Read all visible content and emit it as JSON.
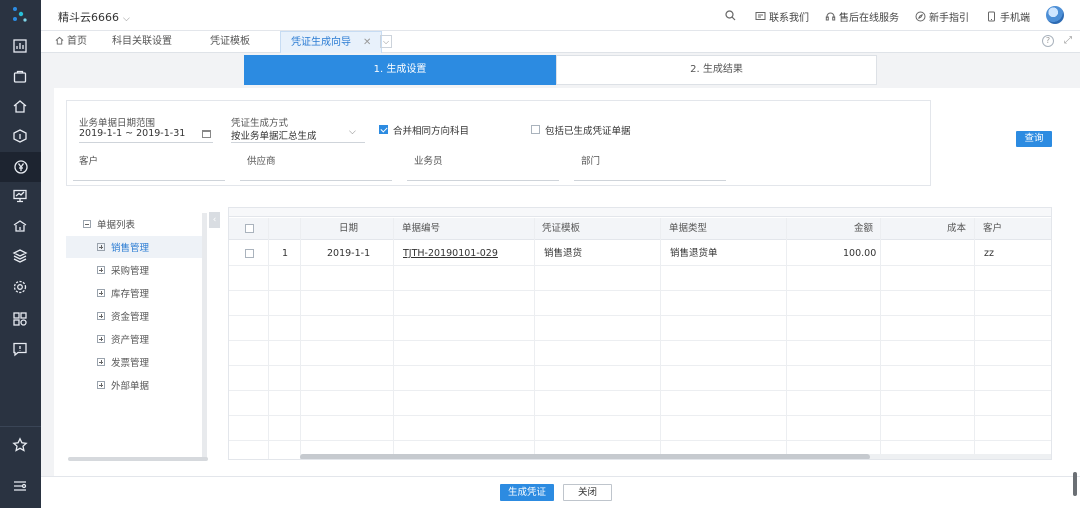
{
  "app": {
    "company_name": "精斗云6666",
    "header_links": [
      {
        "label": "联系我们",
        "icon": "message-icon"
      },
      {
        "label": "售后在线服务",
        "icon": "headset-icon"
      },
      {
        "label": "新手指引",
        "icon": "compass-icon"
      },
      {
        "label": "手机端",
        "icon": "phone-icon"
      }
    ]
  },
  "sidebar": {
    "icons": [
      "chart-icon",
      "bag-icon",
      "home-icon",
      "inventory-icon",
      "yen-icon",
      "report-icon",
      "asset-icon",
      "layers-icon",
      "gear-icon",
      "apps-icon",
      "feedback-icon",
      "star-icon",
      "settings-list-icon"
    ],
    "active": "yen-icon"
  },
  "tabs": [
    {
      "label": "首页",
      "icon": "home-icon"
    },
    {
      "label": "科目关联设置"
    },
    {
      "label": "凭证模板"
    },
    {
      "label": "凭证生成向导",
      "active": true
    }
  ],
  "wizard": {
    "step1": "1. 生成设置",
    "step2": "2. 生成结果"
  },
  "filters": {
    "date_range_label": "业务单据日期范围",
    "date_range_value": "2019-1-1 ~ 2019-1-31",
    "method_label": "凭证生成方式",
    "method_value": "按业务单据汇总生成",
    "merge_label": "合并相同方向科目",
    "merge_checked": true,
    "include_label": "包括已生成凭证单据",
    "include_checked": false,
    "customer_label": "客户",
    "supplier_label": "供应商",
    "salesman_label": "业务员",
    "department_label": "部门",
    "query_button": "查询"
  },
  "tree": {
    "root": "单据列表",
    "items": [
      "销售管理",
      "采购管理",
      "库存管理",
      "资金管理",
      "资产管理",
      "发票管理",
      "外部单据"
    ],
    "selected_index": 0
  },
  "grid": {
    "columns": [
      "日期",
      "单据编号",
      "凭证模板",
      "单据类型",
      "金额",
      "成本",
      "客户"
    ],
    "rows": [
      {
        "index": "1",
        "date": "2019-1-1",
        "doc_no": "TJTH-20190101-029",
        "template": "销售退货",
        "type": "销售退货单",
        "amount": "100.00",
        "cost": "",
        "customer": "zz"
      }
    ]
  },
  "footer": {
    "generate_button": "生成凭证",
    "close_button": "关闭"
  },
  "colors": {
    "primary": "#2c8be1",
    "sidebar_bg": "#2a3341"
  }
}
